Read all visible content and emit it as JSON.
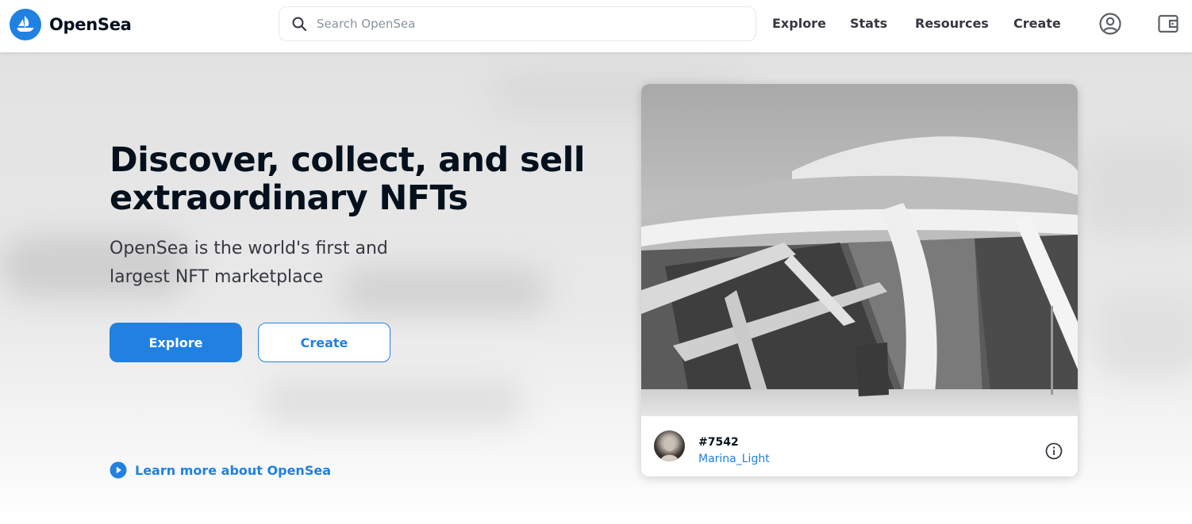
{
  "app": {
    "name": "OpenSea",
    "brand_color": "#2081e2"
  },
  "header": {
    "logo_text": "OpenSea",
    "search": {
      "placeholder": "Search OpenSea",
      "value": ""
    },
    "nav": [
      {
        "label": "Explore"
      },
      {
        "label": "Stats"
      },
      {
        "label": "Resources"
      },
      {
        "label": "Create"
      }
    ],
    "icons": [
      "account-icon",
      "wallet-icon"
    ]
  },
  "hero": {
    "headline": "Discover, collect, and sell extraordinary NFTs",
    "subline": "OpenSea is the world's first and largest NFT marketplace",
    "primary_button": "Explore",
    "secondary_button": "Create",
    "learn_more": "Learn more about OpenSea"
  },
  "featured": {
    "token_id": "#7542",
    "owner": "Marina_Light"
  }
}
